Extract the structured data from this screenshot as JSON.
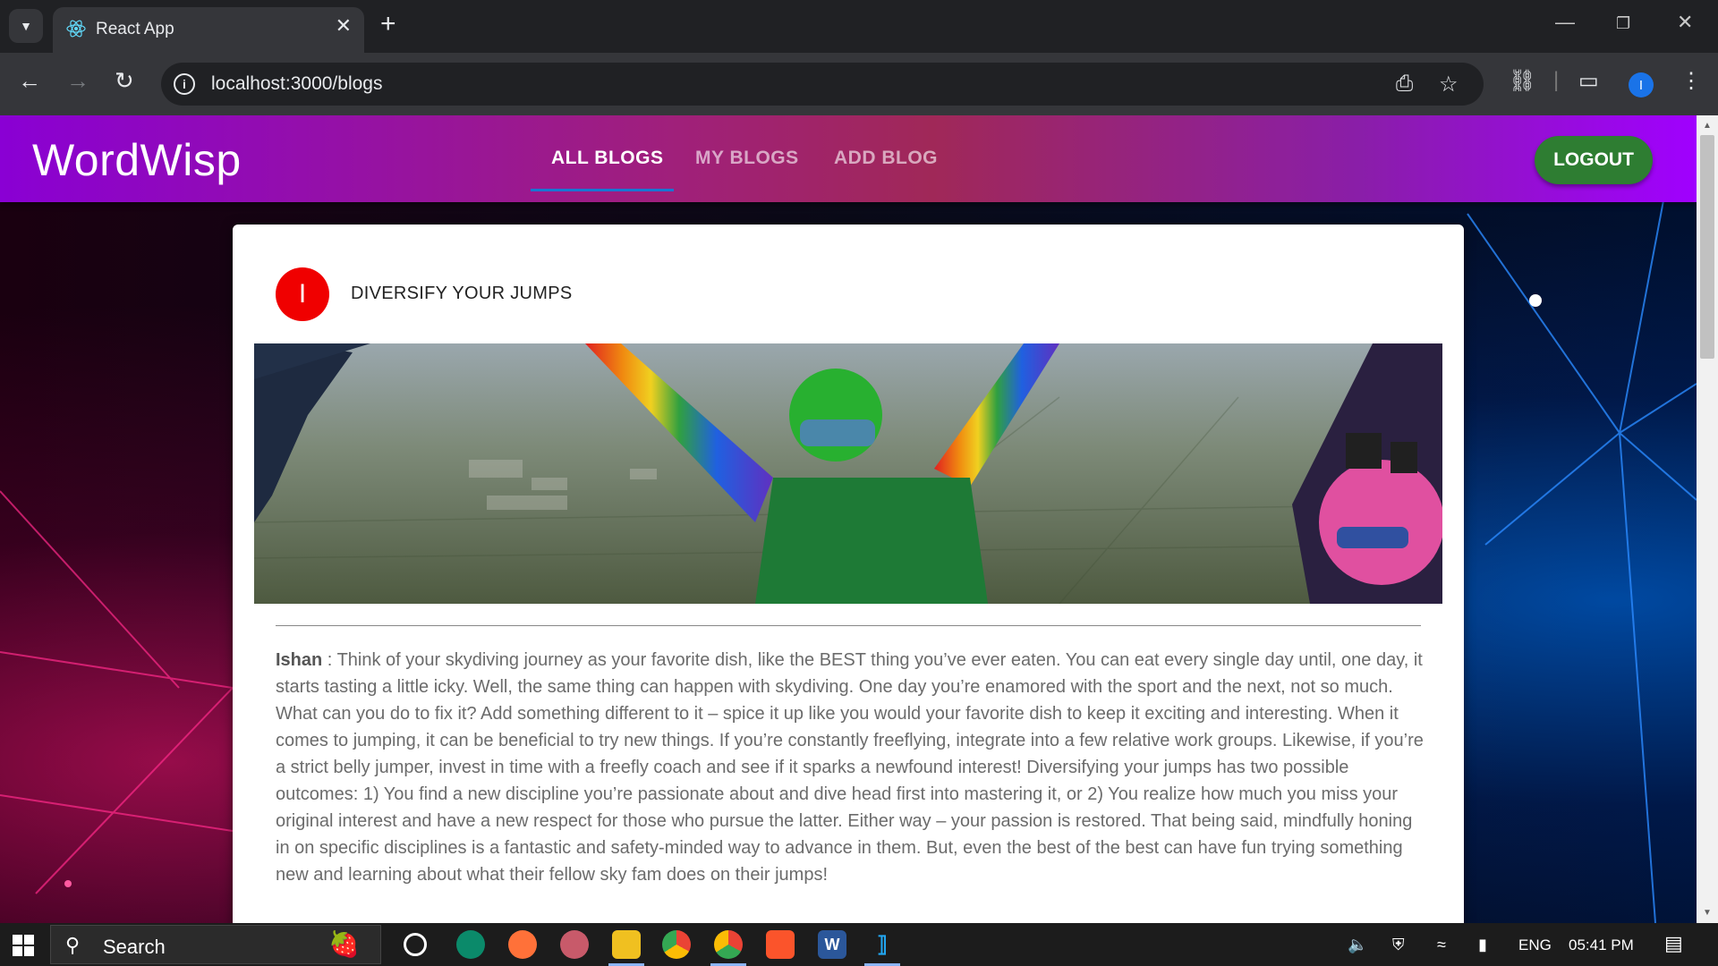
{
  "browser": {
    "tab_title": "React App",
    "url": "localhost:3000/blogs",
    "profile_initial": "I"
  },
  "app": {
    "brand": "WordWisp",
    "nav": {
      "all_blogs": "ALL BLOGS",
      "my_blogs": "MY BLOGS",
      "add_blog": "ADD BLOG"
    },
    "logout_label": "LOGOUT"
  },
  "post": {
    "avatar_initial": "I",
    "title": "DIVERSIFY YOUR JUMPS",
    "author": "Ishan",
    "separator": " : ",
    "body": "Think of your skydiving journey as your favorite dish, like the BEST thing you’ve ever eaten. You can eat every single day until, one day, it starts tasting a little icky. Well, the same thing can happen with skydiving. One day you’re enamored with the sport and the next, not so much. What can you do to fix it? Add something different to it – spice it up like you would your favorite dish to keep it exciting and interesting. When it comes to jumping, it can be beneficial to try new things. If you’re constantly freeflying, integrate into a few relative work groups. Likewise, if you’re a strict belly jumper, invest in time with a freefly coach and see if it sparks a newfound interest! Diversifying your jumps has two possible outcomes: 1) You find a new discipline you’re passionate about and dive head first into mastering it, or 2) You realize how much you miss your original interest and have a new respect for those who pursue the latter. Either way – your passion is restored. That being said, mindfully honing in on specific disciplines is a fantastic and safety-minded way to advance in them. But, even the best of the best can have fun trying something new and learning about what their fellow sky fam does on their jumps!"
  },
  "taskbar": {
    "search_label": "Search",
    "language": "ENG",
    "time": "05:41 PM"
  },
  "colors": {
    "appbar_start": "#8a00d4",
    "appbar_end": "#a000ff",
    "logout_bg": "#2e7d32",
    "avatar_bg": "#f00000",
    "nav_indicator": "#1976d2"
  }
}
